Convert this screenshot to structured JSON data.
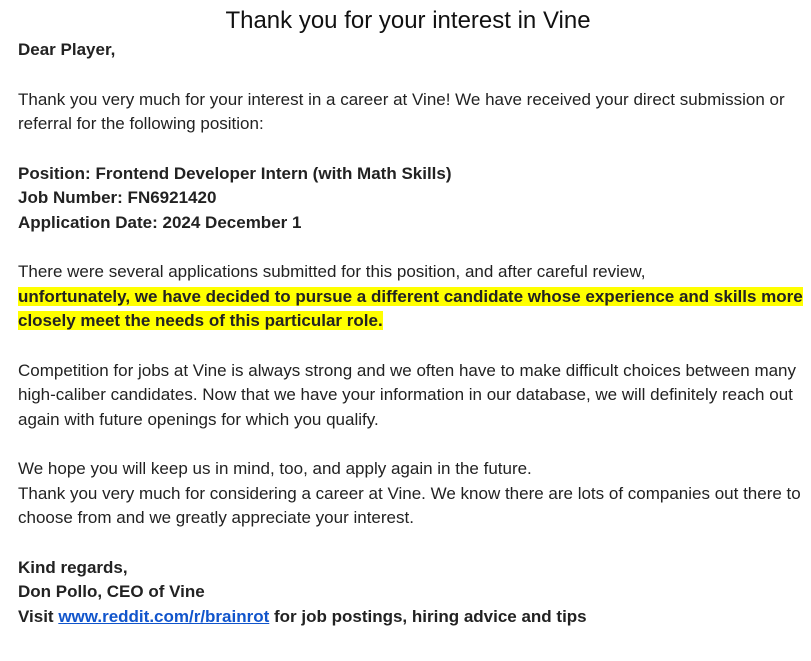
{
  "email": {
    "title": "Thank you for your interest in Vine",
    "greeting": "Dear Player,",
    "intro": "Thank you very much for your interest in a career at Vine! We have received your direct submission or referral for the following position:",
    "position": "Position: Frontend Developer Intern (with Math Skills)",
    "job_number": "Job Number: FN6921420",
    "application_date": "Application Date: 2024 December 1",
    "review_text": "There were several applications submitted for this position, and after careful review,",
    "rejection_highlight": "unfortunately, we have decided to pursue a different candidate whose experience and skills more closely meet the needs of this particular role.",
    "competition": "Competition for jobs at Vine is always strong and we often have to make difficult choices between many high-caliber candidates. Now that we have your information in our database, we will definitely reach out again with future openings for which you qualify.",
    "hope": "We hope you will keep us in mind, too, and apply again in the future.",
    "thanks": "Thank you very much for considering a career at Vine. We know there are lots of companies out there to choose from and we greatly appreciate your interest.",
    "closing": "Kind regards,",
    "signature": "Don Pollo, CEO of Vine",
    "footer_prefix": "Visit ",
    "footer_link": "www.reddit.com/r/brainrot",
    "footer_suffix": " for job postings, hiring advice and tips",
    "highlight_color": "#ffff00",
    "link_color": "#1155cc"
  }
}
